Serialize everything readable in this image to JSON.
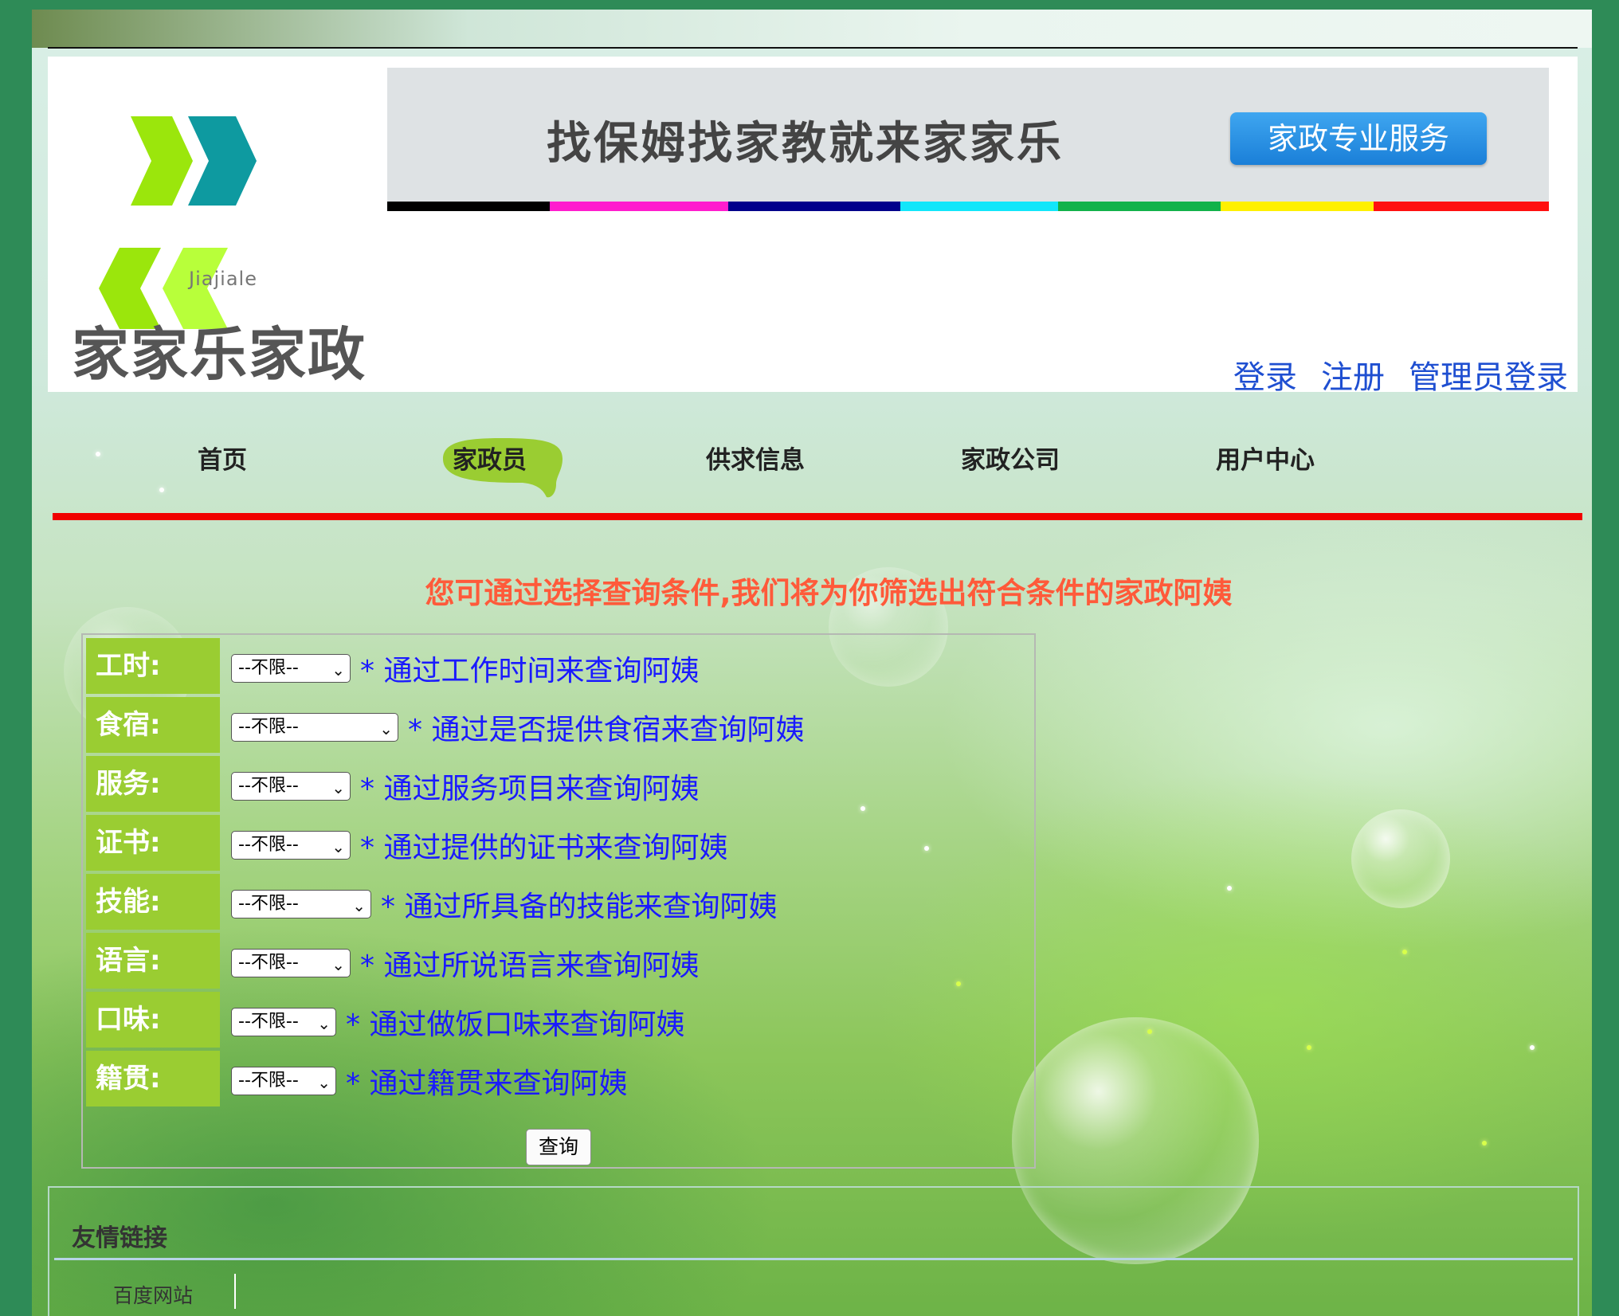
{
  "header": {
    "logo_sub": "Jiajiale",
    "logo_name": "家家乐家政",
    "banner_text": "找保姆找家教就来家家乐",
    "banner_button": "家政专业服务",
    "auth": {
      "login": "登录",
      "register": "注册",
      "admin_login": "管理员登录"
    }
  },
  "colors": {
    "accent_green": "#9acd32",
    "red_line": "#f00000",
    "notice": "#ff5a3a",
    "hint": "#1a1aff",
    "link": "#1f4fd1",
    "color_bar": [
      "#000000",
      "#ff1dce",
      "#00008b",
      "#12e6fa",
      "#12b24a",
      "#fff000",
      "#ff1010"
    ]
  },
  "nav": {
    "items": [
      {
        "label": "首页"
      },
      {
        "label": "家政员"
      },
      {
        "label": "供求信息"
      },
      {
        "label": "家政公司"
      },
      {
        "label": "用户中心"
      }
    ],
    "active_index": 1
  },
  "search": {
    "notice": "您可通过选择查询条件,我们将为你筛选出符合条件的家政阿姨",
    "rows": [
      {
        "label": "工时:",
        "value": "--不限--",
        "hint": "* 通过工作时间来查询阿姨"
      },
      {
        "label": "食宿:",
        "value": "--不限--",
        "hint": "* 通过是否提供食宿来查询阿姨"
      },
      {
        "label": "服务:",
        "value": "--不限--",
        "hint": "* 通过服务项目来查询阿姨"
      },
      {
        "label": "证书:",
        "value": "--不限--",
        "hint": "* 通过提供的证书来查询阿姨"
      },
      {
        "label": "技能:",
        "value": "--不限--",
        "hint": "* 通过所具备的技能来查询阿姨"
      },
      {
        "label": "语言:",
        "value": "--不限--",
        "hint": "* 通过所说语言来查询阿姨"
      },
      {
        "label": "口味:",
        "value": "--不限--",
        "hint": "* 通过做饭口味来查询阿姨"
      },
      {
        "label": "籍贯:",
        "value": "--不限--",
        "hint": "* 通过籍贯来查询阿姨"
      }
    ],
    "submit_label": "查询"
  },
  "links": {
    "title": "友情链接",
    "items": [
      {
        "label": "百度网站"
      }
    ]
  }
}
